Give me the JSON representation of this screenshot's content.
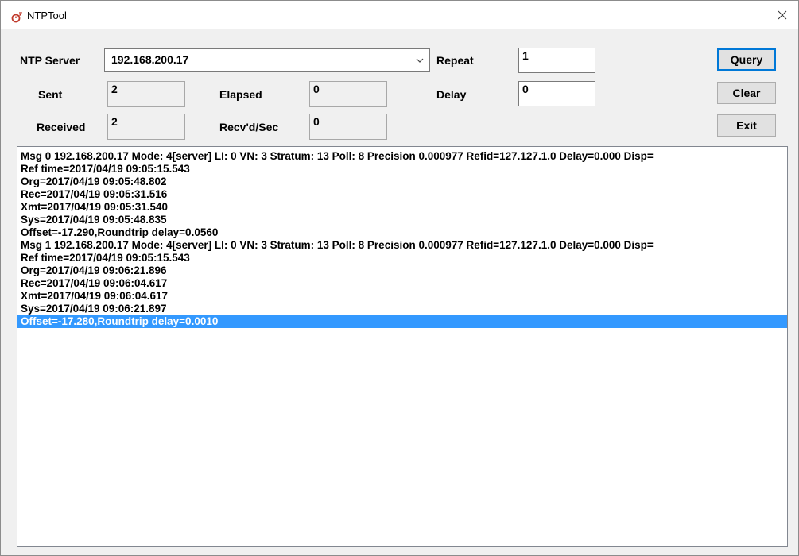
{
  "window": {
    "title": "NTPTool"
  },
  "labels": {
    "ntp_server": "NTP Server",
    "repeat": "Repeat",
    "sent": "Sent",
    "elapsed": "Elapsed",
    "delay": "Delay",
    "received": "Received",
    "recvd_sec": "Recv'd/Sec"
  },
  "fields": {
    "ntp_server": "192.168.200.17",
    "repeat": "1",
    "sent": "2",
    "elapsed": "0",
    "delay": "0",
    "received": "2",
    "recvd_sec": "0"
  },
  "buttons": {
    "query": "Query",
    "clear": "Clear",
    "exit": "Exit"
  },
  "output": {
    "lines": [
      "Msg 0 192.168.200.17 Mode: 4[server] LI: 0 VN: 3 Stratum: 13 Poll: 8 Precision 0.000977 Refid=127.127.1.0 Delay=0.000 Disp=",
      "Ref time=2017/04/19 09:05:15.543",
      "Org=2017/04/19 09:05:48.802",
      "Rec=2017/04/19 09:05:31.516",
      "Xmt=2017/04/19 09:05:31.540",
      "Sys=2017/04/19 09:05:48.835",
      "Offset=-17.290,Roundtrip delay=0.0560",
      "Msg 1 192.168.200.17 Mode: 4[server] LI: 0 VN: 3 Stratum: 13 Poll: 8 Precision 0.000977 Refid=127.127.1.0 Delay=0.000 Disp=",
      "Ref time=2017/04/19 09:05:15.543",
      "Org=2017/04/19 09:06:21.896",
      "Rec=2017/04/19 09:06:04.617",
      "Xmt=2017/04/19 09:06:04.617",
      "Sys=2017/04/19 09:06:21.897",
      "Offset=-17.280,Roundtrip delay=0.0010"
    ],
    "selected_index": 13
  },
  "colors": {
    "selection": "#3399ff",
    "default_button_border": "#0078d7",
    "app_icon": "#c0392b"
  },
  "icons": {
    "app": "clock-app-icon",
    "close": "close-icon",
    "dropdown": "chevron-down-icon"
  }
}
